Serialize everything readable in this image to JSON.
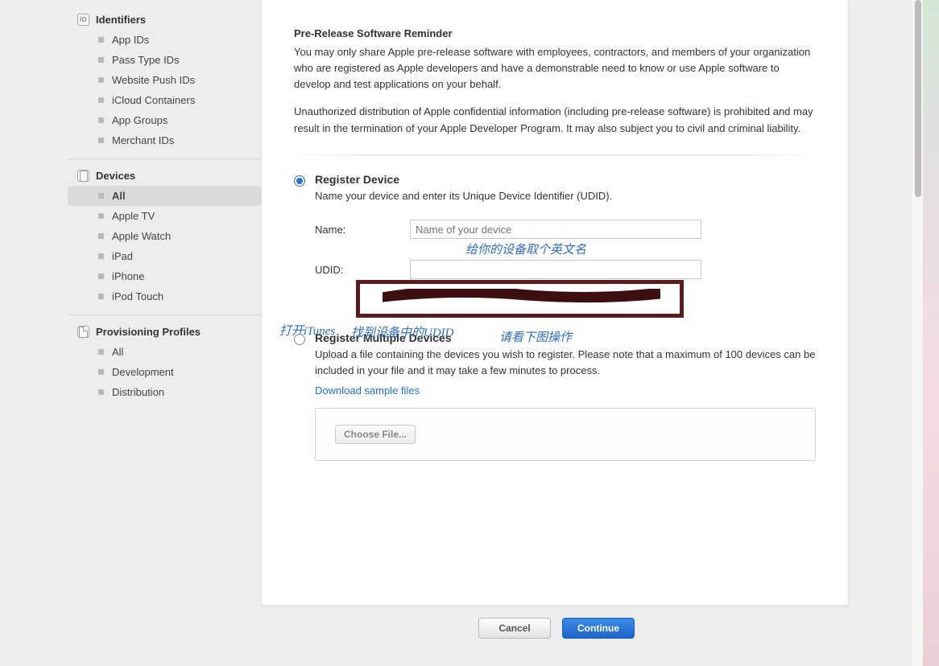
{
  "sidebar": {
    "identifiers": {
      "title": "Identifiers",
      "items": [
        "App IDs",
        "Pass Type IDs",
        "Website Push IDs",
        "iCloud Containers",
        "App Groups",
        "Merchant IDs"
      ]
    },
    "devices": {
      "title": "Devices",
      "selected": "All",
      "items": [
        "All",
        "Apple TV",
        "Apple Watch",
        "iPad",
        "iPhone",
        "iPod Touch"
      ]
    },
    "profiles": {
      "title": "Provisioning Profiles",
      "items": [
        "All",
        "Development",
        "Distribution"
      ]
    }
  },
  "reminder": {
    "heading": "Pre-Release Software Reminder",
    "p1": "You may only share Apple pre-release software with employees, contractors, and members of your organization who are registered as Apple developers and have a demonstrable need to know or use Apple software to develop and test applications on your behalf.",
    "p2": "Unauthorized distribution of Apple confidential information (including pre-release software) is prohibited and may result in the termination of your Apple Developer Program. It may also subject you to civil and criminal liability."
  },
  "register_single": {
    "title": "Register Device",
    "desc": "Name your device and enter its Unique Device Identifier (UDID).",
    "name_label": "Name:",
    "name_placeholder": "Name of your device",
    "udid_label": "UDID:"
  },
  "register_multi": {
    "title": "Register Multiple Devices",
    "desc": "Upload a file containing the devices you wish to register. Please note that a maximum of 100 devices can be included in your file and it may take a few minutes to process.",
    "link": "Download sample files",
    "choose": "Choose File..."
  },
  "annotations": {
    "name_hint": "给你的设备取个英文名",
    "itunes": "打开iTunes",
    "find_udid": "找到设备中的UDID",
    "see_below": "请看下图操作"
  },
  "footer": {
    "cancel": "Cancel",
    "continue": "Continue"
  }
}
